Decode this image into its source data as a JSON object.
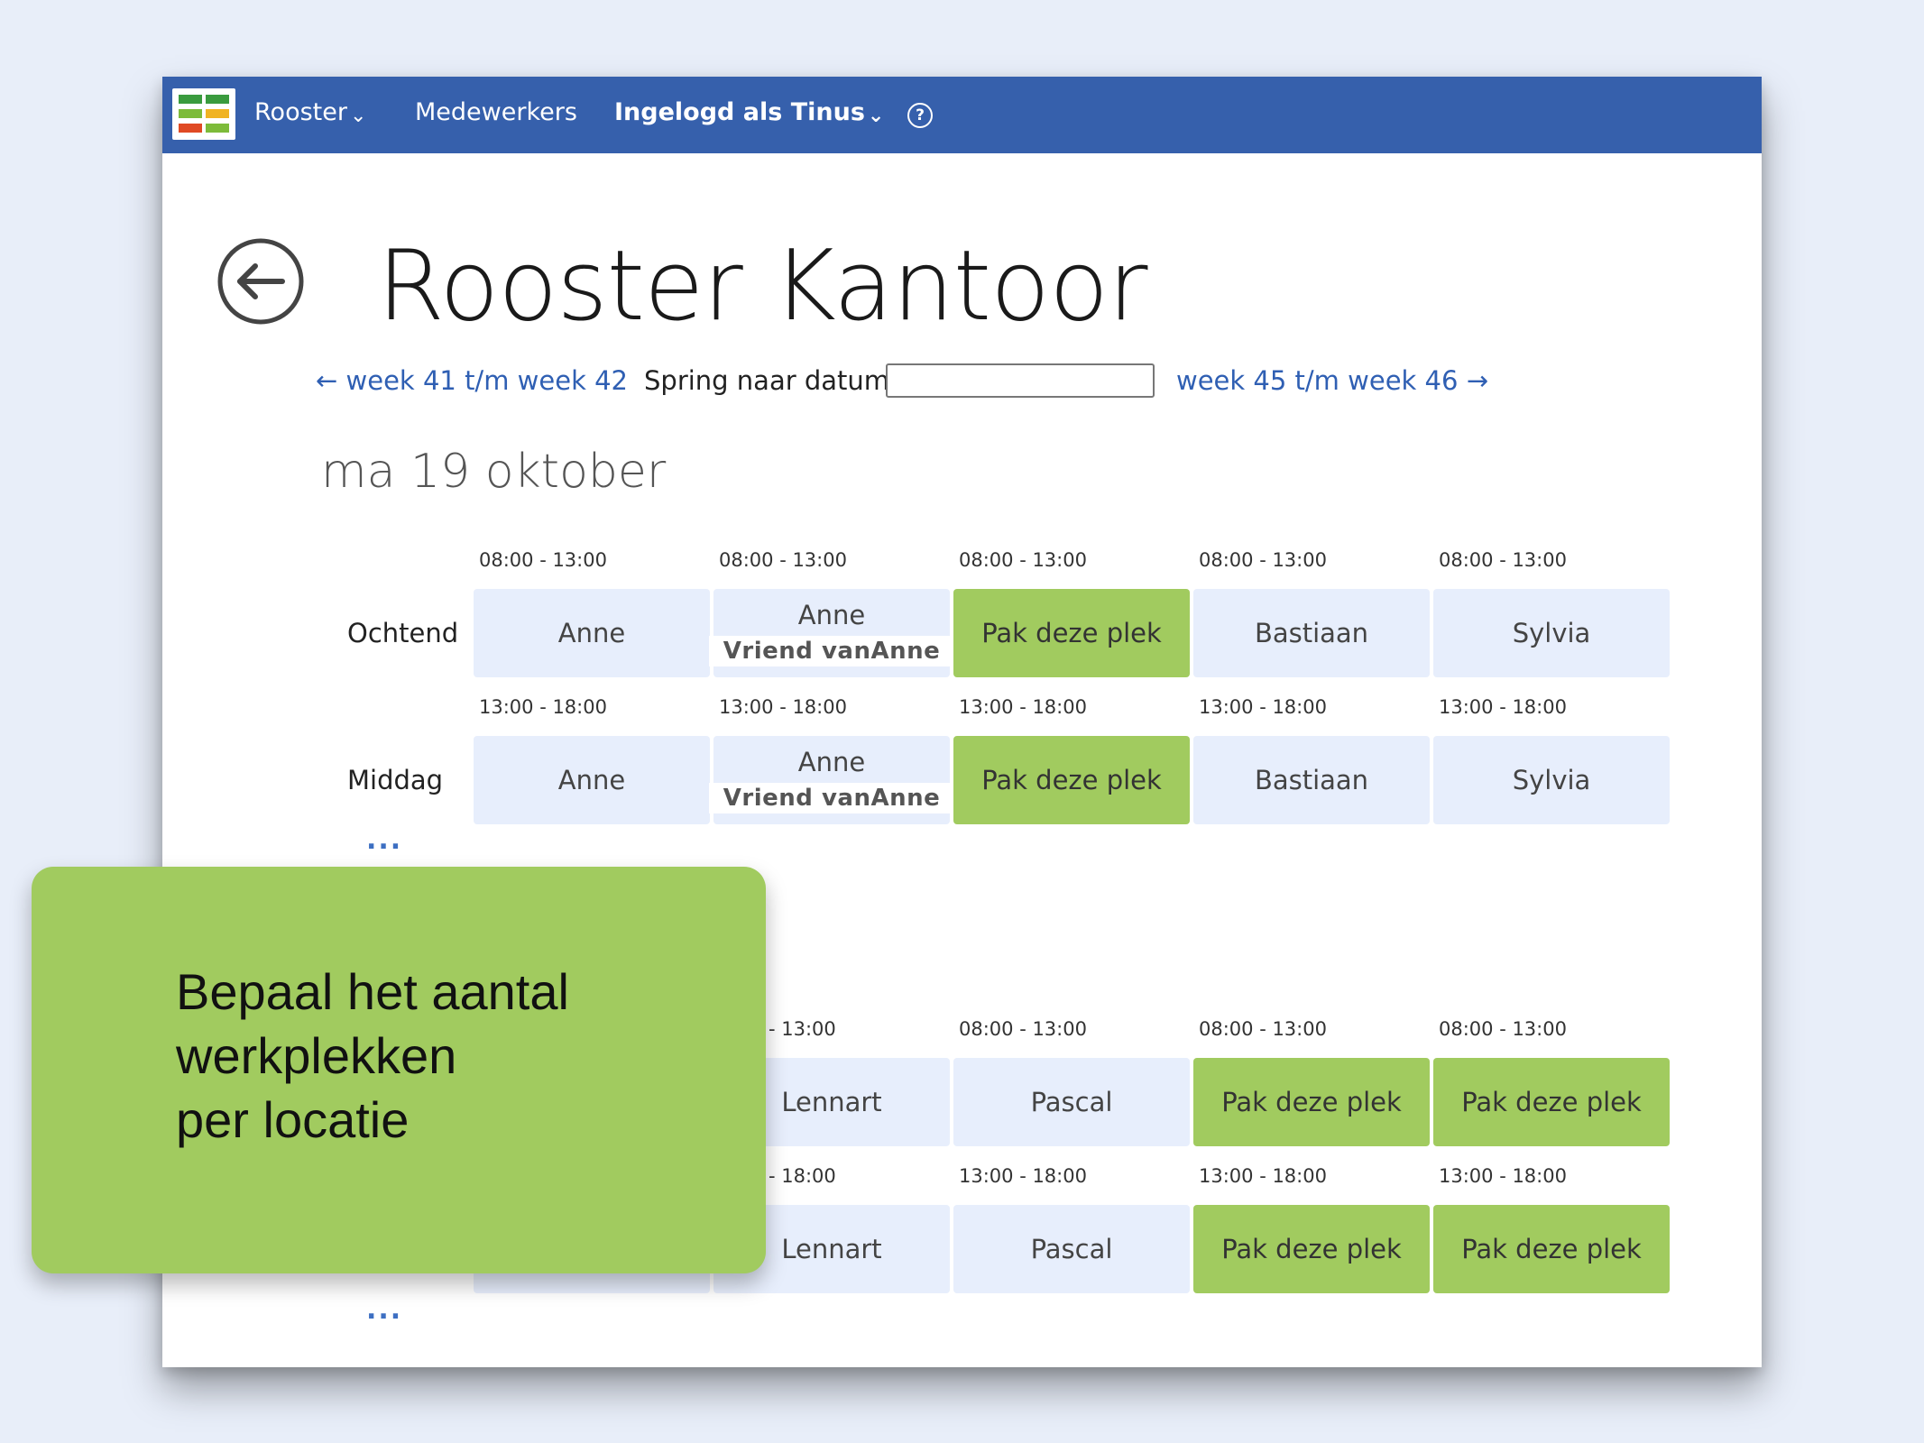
{
  "nav": {
    "rooster_label": "Rooster",
    "medewerkers_label": "Medewerkers",
    "user_label": "Ingelogd als Tinus",
    "help_symbol": "?",
    "background_color": "#3660ac"
  },
  "page": {
    "title": "Rooster Kantoor",
    "prev_weeks": "week 41 t/m week 42",
    "jump_label": "Spring naar datum:",
    "jump_value": "",
    "next_weeks": "week 45 t/m week 46",
    "day_heading": "ma 19 oktober"
  },
  "colors": {
    "free_slot": "#a1cb5f",
    "taken_slot": "#e7eefc",
    "link": "#2f5fb3"
  },
  "section1": {
    "morning": {
      "label": "Ochtend",
      "times": [
        "08:00 - 13:00",
        "08:00 - 13:00",
        "08:00 - 13:00",
        "08:00 - 13:00",
        "08:00 - 13:00"
      ],
      "slots": [
        {
          "name": "Anne",
          "guest": ""
        },
        {
          "name": "Anne",
          "guest": "Vriend vanAnne"
        },
        {
          "name": "Pak deze plek",
          "guest": ""
        },
        {
          "name": "Bastiaan",
          "guest": ""
        },
        {
          "name": "Sylvia",
          "guest": ""
        }
      ]
    },
    "afternoon": {
      "label": "Middag",
      "times": [
        "13:00 - 18:00",
        "13:00 - 18:00",
        "13:00 - 18:00",
        "13:00 - 18:00",
        "13:00 - 18:00"
      ],
      "slots": [
        {
          "name": "Anne",
          "guest": ""
        },
        {
          "name": "Anne",
          "guest": "Vriend vanAnne"
        },
        {
          "name": "Pak deze plek",
          "guest": ""
        },
        {
          "name": "Bastiaan",
          "guest": ""
        },
        {
          "name": "Sylvia",
          "guest": ""
        }
      ]
    },
    "more": "..."
  },
  "section2": {
    "morning": {
      "times": [
        "- 13:00",
        "08:00 - 13:00",
        "08:00 - 13:00",
        "08:00 - 13:00"
      ],
      "slots": [
        "Lennart",
        "Pascal",
        "Pak deze plek",
        "Pak deze plek"
      ]
    },
    "afternoon": {
      "times": [
        "- 18:00",
        "13:00 - 18:00",
        "13:00 - 18:00",
        "13:00 - 18:00"
      ],
      "slots": [
        "Lennart",
        "Pascal",
        "Pak deze plek",
        "Pak deze plek"
      ]
    },
    "more": "..."
  },
  "callout": {
    "lines": [
      "Bepaal het aantal",
      "werkplekken",
      "per locatie"
    ]
  }
}
